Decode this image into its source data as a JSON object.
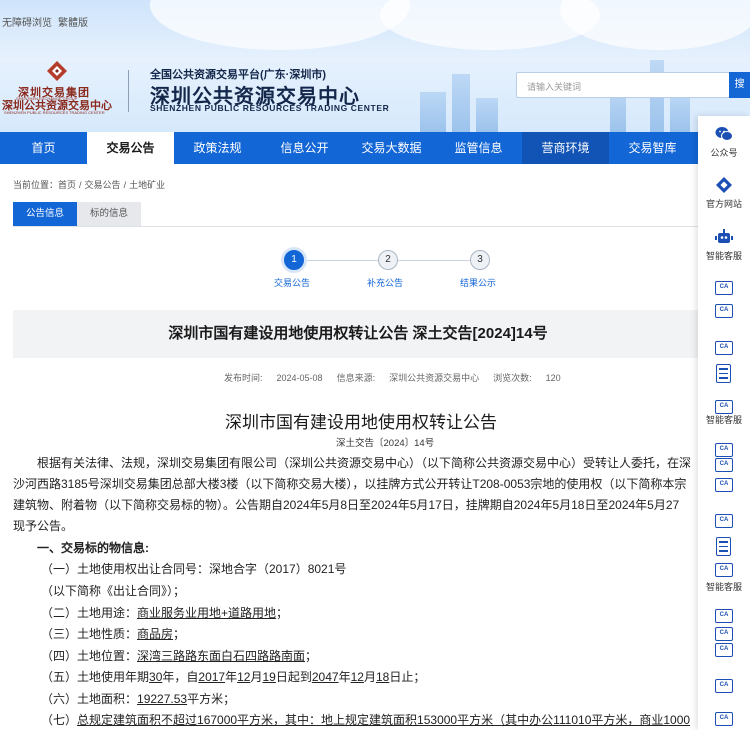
{
  "top_links": [
    "无障碍浏览",
    "繁體版"
  ],
  "logo": {
    "cn": "深圳交易集团",
    "en": "SHENZHEN EXCHANGE GROUP",
    "center": "深圳公共资源交易中心",
    "center_en": "SHENZHEN PUBLIC RESOURCES TRADING CENTER"
  },
  "header": {
    "platform": "全国公共资源交易平台(广东·深圳市)",
    "title": "深圳公共资源交易中心",
    "title_en": "SHENZHEN PUBLIC RESOURCES TRADING CENTER"
  },
  "search": {
    "placeholder": "请输入关键词",
    "button": "搜"
  },
  "nav": [
    "首页",
    "交易公告",
    "政策法规",
    "信息公开",
    "交易大数据",
    "监管信息",
    "营商环境",
    "交易智库"
  ],
  "breadcrumb": {
    "prefix": "当前位置：",
    "items": [
      "首页",
      "交易公告",
      "土地矿业"
    ],
    "sep": "/"
  },
  "subtabs": [
    "公告信息",
    "标的信息"
  ],
  "steps": [
    "交易公告",
    "补充公告",
    "结果公示"
  ],
  "step_numbers": [
    "1",
    "2",
    "3"
  ],
  "article": {
    "heading": "深圳市国有建设用地使用权转让公告 深土交告[2024]14号",
    "meta": {
      "publish_label": "发布时间:",
      "publish_value": "2024-05-08",
      "source_label": "信息来源:",
      "source_value": "深圳公共资源交易中心",
      "views_label": "浏览次数:",
      "views_value": "120"
    },
    "doc_title": "深圳市国有建设用地使用权转让公告",
    "doc_no": "深土交告〔2024〕14号",
    "intro": [
      "根据有关法律、法规，深圳交易集团有限公司（深圳公共资源交易中心）（以下简称公共资源交易中心）受转让人委托，在深",
      "沙河西路3185号深圳交易集团总部大楼3楼（以下简称交易大楼），以挂牌方式公开转让T208-0053宗地的使用权（以下简称本宗",
      "建筑物、附着物（以下简称交易标的物）。公告期自2024年5月8日至2024年5月17日，挂牌期自2024年5月18日至2024年5月27",
      "现予公告。"
    ],
    "section1": "一、交易标的物信息:",
    "items": {
      "i1_a": "（一）土地使用权出让合同号：深地合字（2017）8021号",
      "i1_b": "（以下简称《出让合同》）；",
      "i2_label": "（二）土地用途：",
      "i2_value": "商业服务业用地+道路用地",
      "i2_end": "；",
      "i3_label": "（三）土地性质：",
      "i3_value": "商品房",
      "i3_end": "；",
      "i4_label": "（四）土地位置：",
      "i4_value": "深湾三路路东面白石四路路南面",
      "i4_end": "；",
      "i5_a": "（五）土地使用年期",
      "i5_b": "30",
      "i5_c": "年，自",
      "i5_d": "2017",
      "i5_e": "年",
      "i5_f": "12",
      "i5_g": "月",
      "i5_h": "19",
      "i5_i": "日起到",
      "i5_j": "2047",
      "i5_k": "年",
      "i5_l": "12",
      "i5_m": "月",
      "i5_n": "18",
      "i5_o": "日止；",
      "i6_label": "（六）土地面积：",
      "i6_value": "19227.53",
      "i6_end": "平方米；",
      "i7_label": "（七）",
      "i7_value": "总规定建筑面积不超过167000平方米，其中：地上规定建筑面积153000平方米（其中办公111010平方米，商业1000"
    }
  },
  "right_bar": {
    "wechat": "公众号",
    "official": "官方网站",
    "robot": "智能客服",
    "ca_text": "CA",
    "smart1": "智能客服",
    "smart2": "智能客服"
  }
}
